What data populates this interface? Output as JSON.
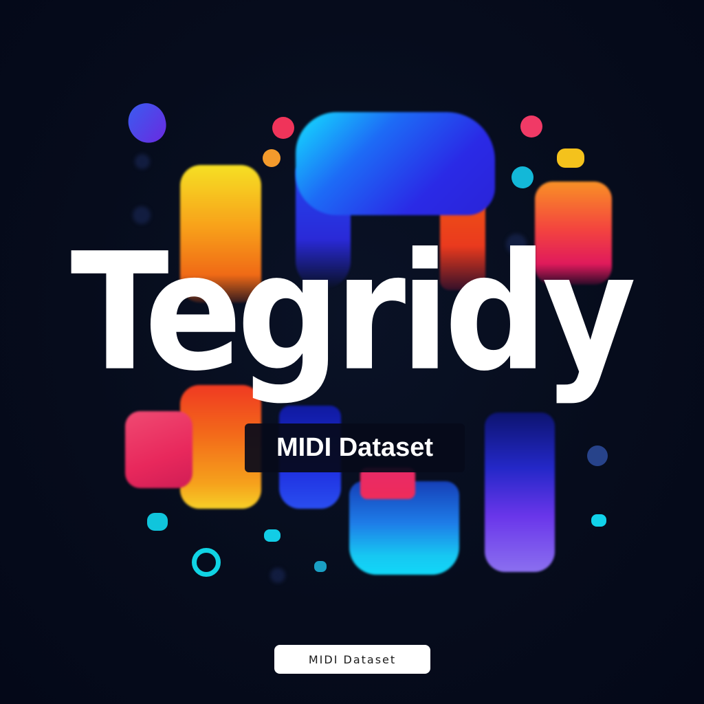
{
  "logo": {
    "title": "Tegridy",
    "subtitle": "MIDI Dataset"
  },
  "badge": {
    "label": "MIDI Dataset"
  },
  "colors": {
    "background": "#050b1c",
    "text": "#ffffff",
    "accent_yellow": "#f6e024",
    "accent_orange": "#f36a1a",
    "accent_red": "#e8285c",
    "accent_blue": "#2a2ae6",
    "accent_cyan": "#14e2ff",
    "accent_purple": "#6a36ea"
  }
}
